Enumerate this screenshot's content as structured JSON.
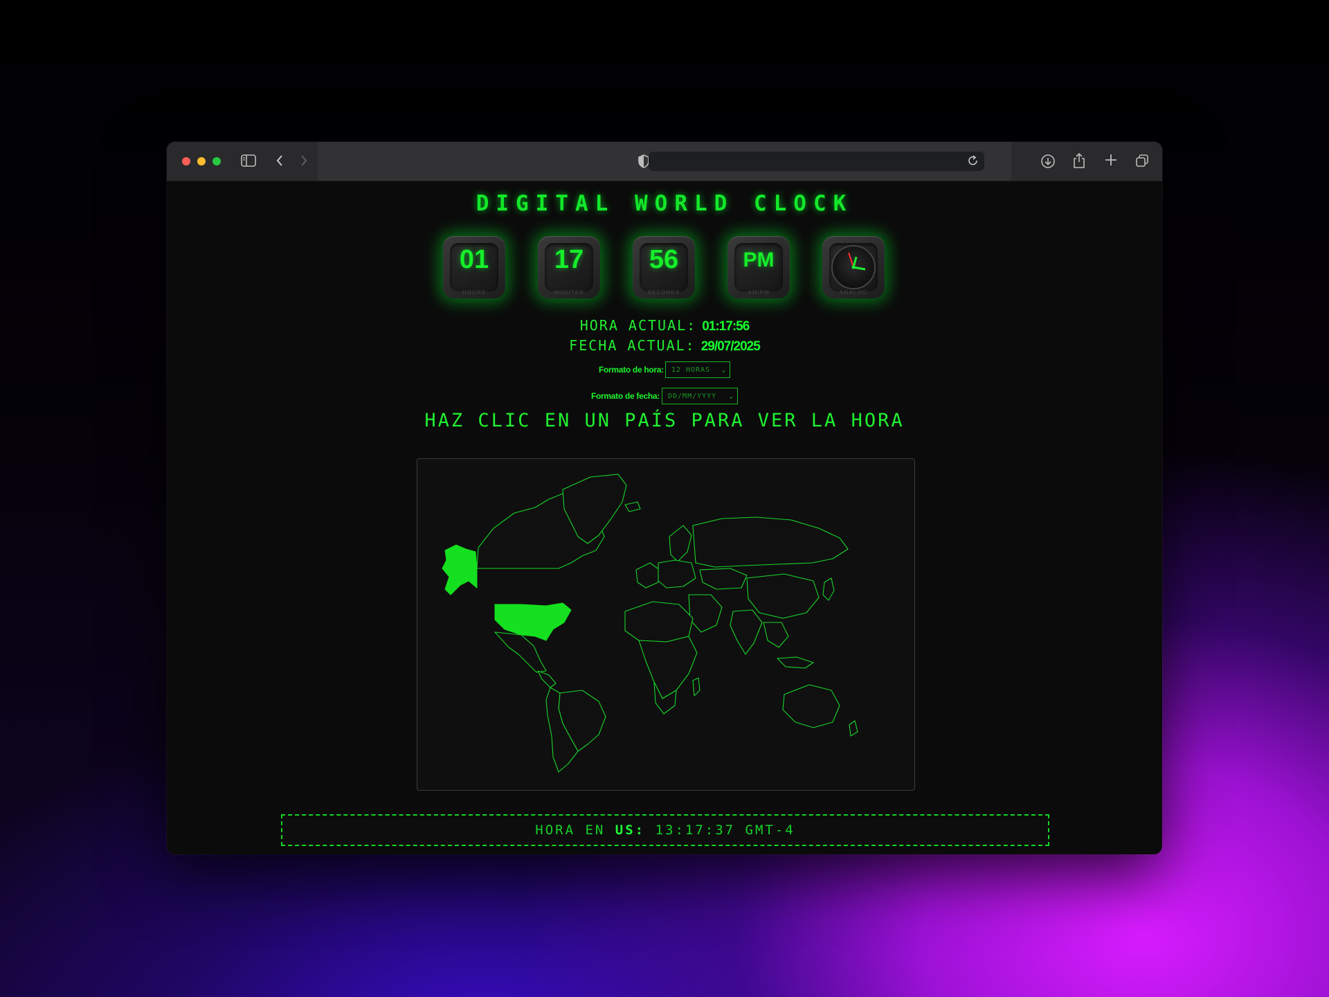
{
  "browser": {
    "url": ""
  },
  "page": {
    "title": "DIGITAL WORLD CLOCK",
    "tiles": [
      {
        "value": "01",
        "caption": "HOURS"
      },
      {
        "value": "17",
        "caption": "MINUTES"
      },
      {
        "value": "56",
        "caption": "SECONDS"
      },
      {
        "value": "PM",
        "caption": "AM/PM"
      },
      {
        "value": "",
        "caption": "ANALOG"
      }
    ],
    "current_time_label": "HORA ACTUAL:",
    "current_time_value": "01:17:56",
    "current_date_label": "FECHA ACTUAL:",
    "current_date_value": "29/07/2025",
    "time_format_label": "Formato de hora:",
    "time_format_value": "12 HORAS",
    "date_format_label": "Formato de fecha:",
    "date_format_value": "DD/MM/YYYY",
    "map_heading": "HAZ CLIC EN UN PAÍS PARA VER LA HORA",
    "selected_country": "US",
    "result_prefix": "HORA EN",
    "result_country": "US:",
    "result_time": "13:17:37 GMT-4"
  },
  "colors": {
    "accent": "#00e81a",
    "background": "#0b0b0b"
  }
}
